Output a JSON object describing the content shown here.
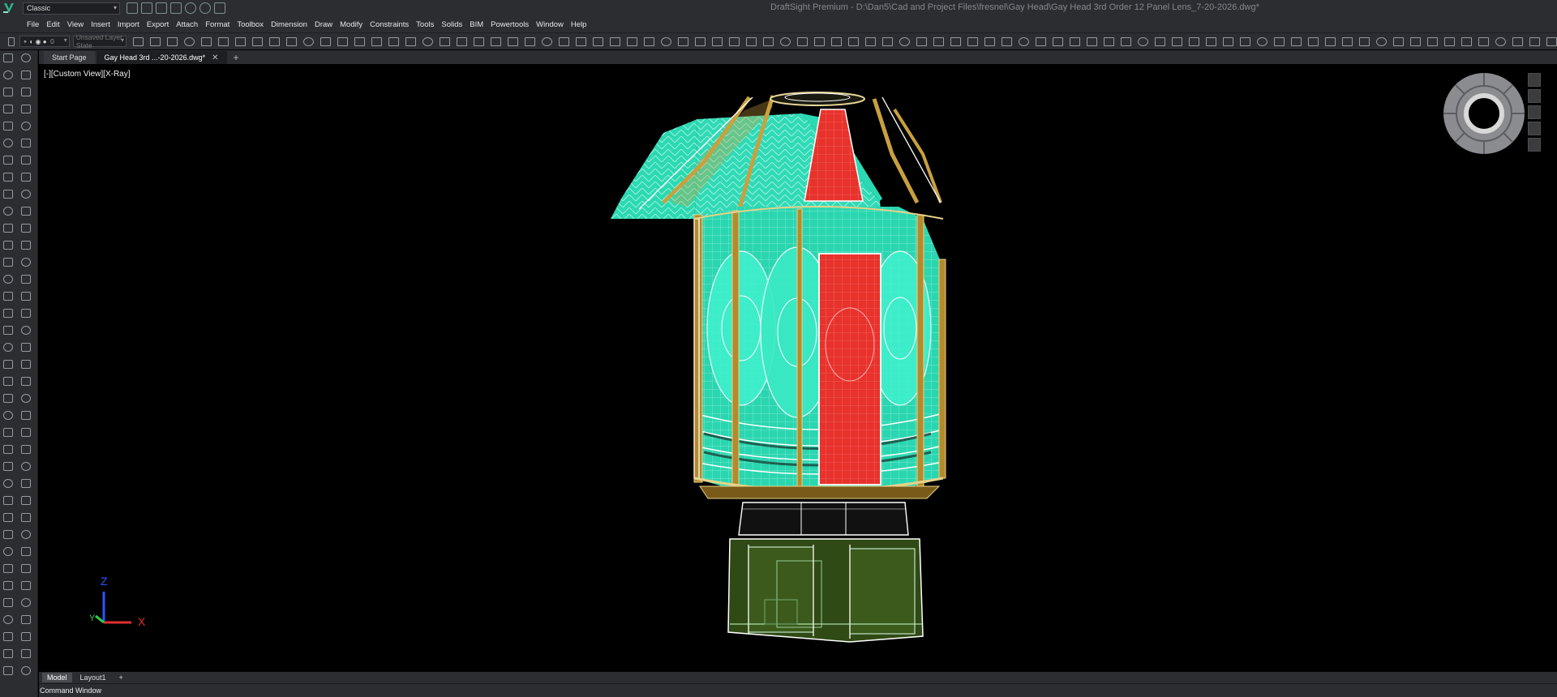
{
  "app": {
    "workspace": "Classic",
    "window_title": "DraftSight Premium - D:\\Dan5\\Cad and Project Files\\fresnel\\Gay Head\\Gay Head 3rd Order 12 Panel Lens_7-20-2026.dwg*"
  },
  "menu": [
    "File",
    "Edit",
    "View",
    "Insert",
    "Import",
    "Export",
    "Attach",
    "Format",
    "Toolbox",
    "Dimension",
    "Draw",
    "Modify",
    "Constraints",
    "Tools",
    "Solids",
    "BIM",
    "Powertools",
    "Window",
    "Help"
  ],
  "toolbar": {
    "layer_value": "0",
    "layer_state_placeholder": "Unsaved Layer State"
  },
  "tabs": {
    "start_page": "Start Page",
    "document": "Gay Head 3rd ...-20-2026.dwg*",
    "close": "✕",
    "add": "+"
  },
  "viewport": {
    "view_label": "[-][Custom View][X-Ray]",
    "ucs": {
      "z": "Z",
      "y": "Y",
      "x": "X"
    },
    "colors": {
      "lens_cyan": "#33e6c0",
      "red_panel": "#e8322c",
      "brass": "#c8a040",
      "pedestal": "#2f4a14"
    }
  },
  "layout_tabs": [
    "Model",
    "Layout1",
    "+"
  ],
  "command_window": "Command Window"
}
